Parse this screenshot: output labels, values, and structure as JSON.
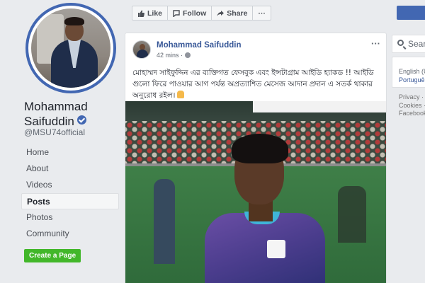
{
  "profile": {
    "name": "Mohammad Saifuddin",
    "handle": "@MSU74official",
    "nav": [
      "Home",
      "About",
      "Videos",
      "Posts",
      "Photos",
      "Community"
    ],
    "active_nav": "Posts",
    "create_page_label": "Create a Page"
  },
  "actions": {
    "like_label": "Like",
    "follow_label": "Follow",
    "share_label": "Share",
    "more_label": "···"
  },
  "post": {
    "author": "Mohammad Saifuddin",
    "time": "42 mins ·",
    "more_label": "···",
    "text": "মোহাম্মদ সাইফুদ্দিন এর ব্যক্তিগত ফেসবুক এবং ইন্সটাগ্রাম আইডি হ্যাকড !! আইডি গুলো ফিরে পাওয়ার আগ পর্যন্ত অপ্রত্যাশিত মেসেজ আদান প্রদান এ সতর্ক থাকার অনুরোধ রইল।"
  },
  "sidebar": {
    "search_placeholder": "Sear",
    "lang_primary": "English (U",
    "lang_secondary": "Portuguê",
    "footer_links": [
      "Privacy ·",
      "Cookies ·",
      "Facebook"
    ]
  },
  "colors": {
    "brand_blue": "#4267b2",
    "link_blue": "#385898",
    "green": "#42b72a",
    "background": "#e9ebee"
  }
}
